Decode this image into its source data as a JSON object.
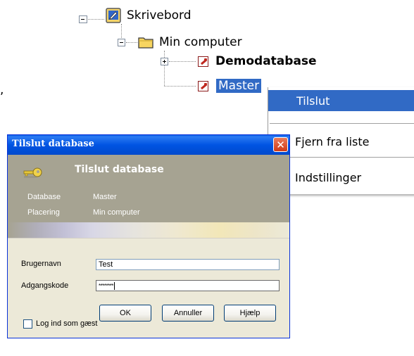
{
  "tree": {
    "desktop": "Skrivebord",
    "my_computer": "Min computer",
    "items": [
      "Demodatabase",
      "Master"
    ]
  },
  "fragment": ",",
  "context_menu": {
    "items": [
      "Tilslut",
      "Fjern fra liste",
      "Indstillinger"
    ]
  },
  "dialog": {
    "title": "Tilslut database",
    "close_glyph": "✕",
    "header": {
      "title": "Tilslut database",
      "database_label": "Database",
      "database_value": "Master",
      "location_label": "Placering",
      "location_value": "Min computer"
    },
    "form": {
      "username_label": "Brugernavn",
      "username_value": "Test",
      "password_label": "Adgangskode",
      "password_value": "********"
    },
    "buttons": {
      "ok": "OK",
      "cancel": "Annuller",
      "help": "Hjælp"
    },
    "guest_checkbox_label": "Log ind som gæst",
    "guest_checked": false
  },
  "colors": {
    "selection": "#316ac5",
    "titlebar": "#0054e3",
    "header_panel": "#a6a392",
    "dialog_bg": "#ece9d8"
  }
}
